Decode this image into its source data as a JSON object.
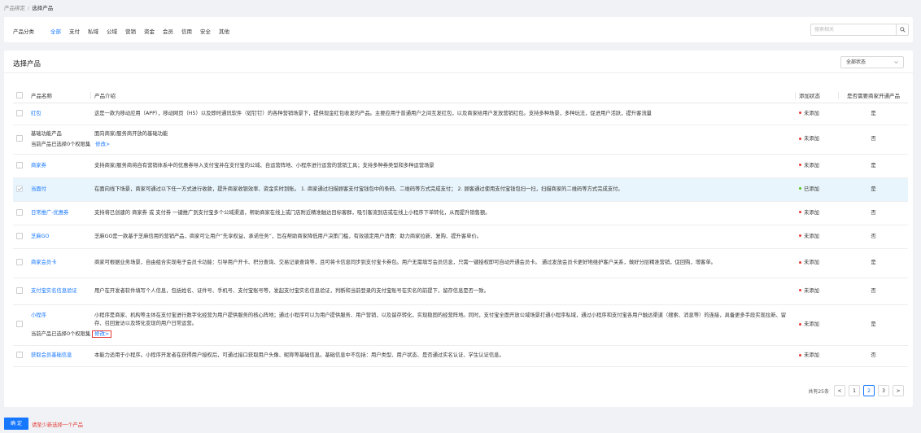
{
  "breadcrumb": {
    "parent": "产品绑定",
    "separator": "/",
    "current": "选择产品"
  },
  "filter": {
    "label": "产品分类",
    "categories": [
      "全部",
      "支付",
      "私域",
      "公域",
      "营销",
      "资金",
      "会员",
      "信用",
      "安全",
      "其他"
    ],
    "active": "全部",
    "search_placeholder": "搜索相关"
  },
  "main": {
    "title": "选择产品",
    "status_select": "全部状态"
  },
  "table": {
    "headers": {
      "name": "产品名称",
      "intro": "产品介绍",
      "status": "添加状态",
      "merchant": "是否需要商家开通产品"
    },
    "rows": [
      {
        "name": "红包",
        "link": true,
        "intro": "这是一款为移动应用（APP），移动网页（H5）以及即时通讯软件（如钉钉）的各种营销场景下，提供现金红包收发的产品。主要应用于普通用户之间互发红包，以及商家给用户发放营销红包。支持多种场景，多种玩法，促进用户活跃，提升客流量",
        "status": "未添加",
        "merchant": "是"
      },
      {
        "name": "基础功能产品",
        "link": false,
        "intro": "面向商家/服务商开放的基础功能",
        "status": "未添加",
        "merchant": "否",
        "sub": "当前产品已选择0个权限集",
        "edit": "修改>"
      },
      {
        "name": "商家券",
        "link": true,
        "intro": "支持商家/服务商将自有营销体系中的优惠券导入支付宝并在支付宝的公域、自运营阵地、小程序进行运营的营销工具；支持多种券类型和多种运营场景",
        "status": "未添加",
        "merchant": "是"
      },
      {
        "name": "当面付",
        "link": true,
        "intro": "在面向线下场景，商家可通过以下任一方式进行收款，提升商家收银效率、资金实时到账。 1. 商家通过扫描顾客支付宝钱包中的条码、二维码等方式完成支付； 2. 顾客通过使用支付宝钱包扫一扫，扫描商家的二维码等方式完成支付。",
        "status": "已添加",
        "merchant": "是",
        "selected": true
      },
      {
        "name": "日常推广-优惠券",
        "link": true,
        "intro": "支持将已创建的 商家券 或 支付券 一键推广到支付宝多个公域渠道，帮助商家在线上或门店附近精准触达目标客群，吸引客流到店或在线上小程序下单转化，从而提升销售额。",
        "status": "未添加",
        "merchant": "否"
      },
      {
        "name": "芝麻GO",
        "link": true,
        "intro": "芝麻GO是一款基于芝麻信用的营销产品，商家可让用户“先享权益、承诺任务”，旨在帮助商家降低用户决策门槛，有效锁定用户消费：助力商家拉新、复购、提升客单价。",
        "status": "未添加",
        "merchant": "否"
      },
      {
        "name": "商家会员卡",
        "link": true,
        "intro": "商家可根据业务场景，自由组合实现电子会员卡功能：引导用户开卡、积分查询、交易记录查询等，且可将卡信息同步到支付宝卡券包。用户无需填写会员信息，只需一键授权即可自动开通会员卡。 通过发放会员卡更好地维护客户关系，做好分层精准营销，促回购，增客单。",
        "status": "未添加",
        "merchant": "是"
      },
      {
        "name": "支付宝实名信息验证",
        "link": true,
        "intro": "用户在开发者软件填写个人信息，包括姓名、证件号、手机号、支付宝账号等，发起支付宝实名信息验证，判断和当前登录的支付宝账号在实名的前提下，留存信息是否一致。",
        "status": "未添加",
        "merchant": "否"
      },
      {
        "name": "小程序",
        "link": true,
        "intro": "小程序是商家、机构等主体在支付宝进行数字化经营为用户提供服务的核心阵地；通过小程序可以为用户提供服务、用户营销，以及留存转化，实现稳固的经营阵地。同时，支付宝全面开放公域场景打通小程序私域，通过小程序和支付宝各用户触达渠道（搜索、消息等）的连接，具备更多手段实现拉新、留存、召回复访以及转化变现的用户日常运营。",
        "status": "未添加",
        "merchant": "是",
        "sub": "当前产品已选择0个权限集",
        "edit": "修改>",
        "edit_boxed": true
      },
      {
        "name": "获取会员基础信息",
        "link": true,
        "intro": "本能力适用于小程序。小程序开发者在获得用户授权后，可通过接口获取用户头像、昵称等基础信息。基础信息中不包括：用户类型、用户状态、是否通过实名认证、学生认证信息。",
        "status": "未添加",
        "merchant": "否"
      }
    ]
  },
  "pagination": {
    "total": "共有25条",
    "prev": "<",
    "pages": [
      "1",
      "2",
      "3"
    ],
    "current": "2",
    "next": ">"
  },
  "footer": {
    "confirm": "确 定",
    "hint": "请至少新选择一个产品"
  },
  "colors": {
    "accent": "#1677ff",
    "danger": "#e53935",
    "success": "#52c41a",
    "selected_row": "#e9f5fc"
  }
}
